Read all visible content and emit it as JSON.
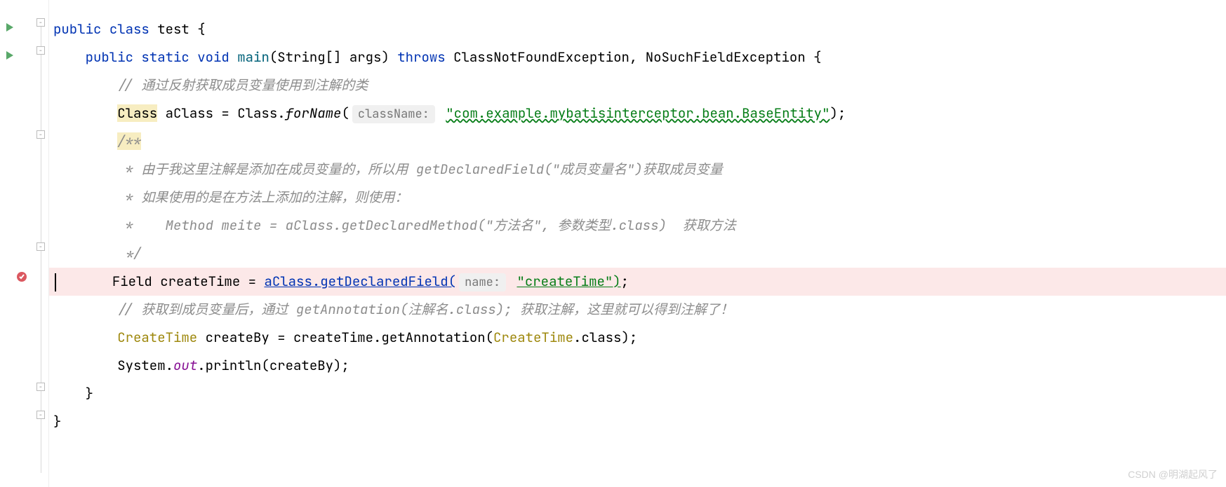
{
  "code": {
    "kw_public": "public",
    "kw_class": "class",
    "class_name": "test",
    "kw_static": "static",
    "kw_void": "void",
    "method_main": "main",
    "main_params": "(String[] args)",
    "kw_throws": "throws",
    "exc1": "ClassNotFoundException",
    "exc2": "NoSuchFieldException",
    "comment1": "// 通过反射获取成员变量使用到注解的类",
    "class_type": "Class",
    "var_aClass": "aClass",
    "eq": " = ",
    "class_lit": "Class",
    "forName": "forName",
    "hint_className": "className:",
    "str_entity": "\"com.example.mybatisinterceptor.bean.BaseEntity\"",
    "doc_open": "/**",
    "doc_l1": " * 由于我这里注解是添加在成员变量的，所以用 getDeclaredField(\"成员变量名\")获取成员变量",
    "doc_l2": " * 如果使用的是在方法上添加的注解，则使用：",
    "doc_l3": " *    Method meite = aClass.getDeclaredMethod(\"方法名\", 参数类型.class)  获取方法",
    "doc_close": " */",
    "field_type": "Field",
    "var_createTime": "createTime",
    "call_getDeclaredField": "aClass.getDeclaredField(",
    "hint_name": "name:",
    "str_createTime": "\"createTime\")",
    "semicolon": ";",
    "comment2": "// 获取到成员变量后，通过 getAnnotation(注解名.class); 获取注解，这里就可以得到注解了！",
    "type_CreateTime": "CreateTime",
    "var_createBy": "createBy",
    "call_getAnnotation_pre": " = createTime.getAnnotation(",
    "dot_class": ".class);",
    "sysout_pre": "System.",
    "sysout_out": "out",
    "sysout_post": ".println(createBy);"
  },
  "watermark": "CSDN @明湖起风了"
}
